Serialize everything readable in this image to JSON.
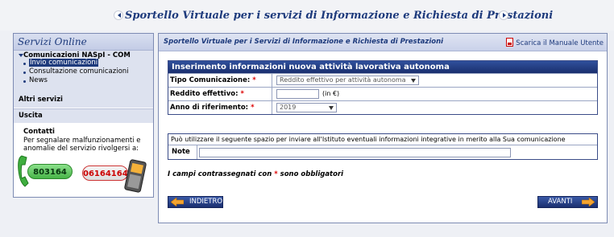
{
  "banner": {
    "title": "Sportello Virtuale per i servizi di Informazione e Richiesta di Prestazioni"
  },
  "sidebar": {
    "title": "Servizi Online",
    "section_title": "Comunicazioni NASpI - COM",
    "items": [
      {
        "label": "Invio comunicazioni",
        "active": true
      },
      {
        "label": "Consultazione comunicazioni",
        "active": false
      },
      {
        "label": "News",
        "active": false
      }
    ],
    "altri_servizi": "Altri servizi",
    "uscita": "Uscita",
    "contatti_title": "Contatti",
    "contatti_text": "Per segnalare malfunzionamenti e anomalie del servizio rivolgersi a:",
    "phone_landline": "803164",
    "phone_mobile": "06164164"
  },
  "main": {
    "header_title": "Sportello Virtuale per i Servizi di Informazione e Richiesta di Prestazioni",
    "manual_link": "Scarica il Manuale Utente",
    "form_title": "Inserimento informazioni nuova attività lavorativa autonoma",
    "fields": {
      "tipo_label": "Tipo Comunicazione:",
      "tipo_value": "Reddito effettivo per attività autonoma",
      "reddito_label": "Reddito effettivo:",
      "reddito_value": "",
      "reddito_unit": "(in €)",
      "anno_label": "Anno di riferimento:",
      "anno_value": "2019",
      "required_mark": "*"
    },
    "note_info": "Può utilizzare il seguente spazio per inviare all'Istituto eventuali informazioni integrative in merito alla Sua comunicazione",
    "note_label": "Note",
    "note_value": "",
    "required_note_prefix": "I campi contrassegnati con",
    "required_note_star": "*",
    "required_note_suffix": "sono obbligatori",
    "back_button": "INDIETRO",
    "next_button": "AVANTI"
  },
  "colors": {
    "brand": "#1d3a7c",
    "header_bar": "#1a2f6e",
    "required": "#dd0000",
    "landline_badge": "#48b448",
    "mobile_badge_border": "#cc3333"
  },
  "icons": [
    "nav-left-icon",
    "nav-right-icon",
    "pdf-icon",
    "telephone-handset-icon",
    "mobile-phone-icon",
    "arrow-left-icon",
    "arrow-right-icon",
    "chevron-down-icon"
  ]
}
